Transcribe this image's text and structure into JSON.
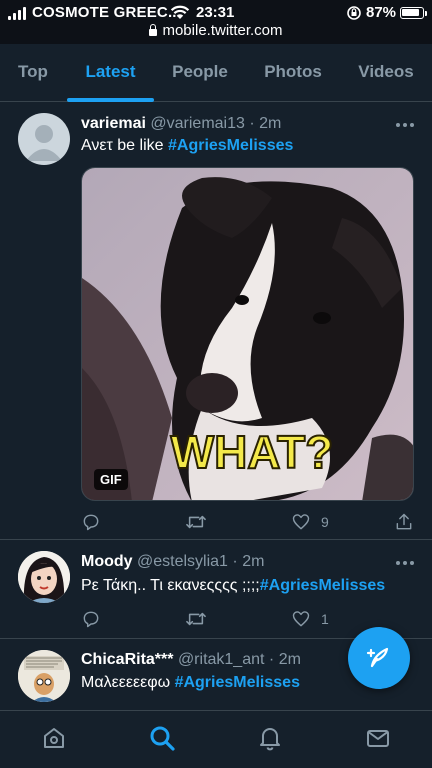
{
  "status_bar": {
    "carrier": "COSMOTE GREEC...",
    "time": "23:31",
    "battery": "87%",
    "battery_level": 0.87,
    "url": "mobile.twitter.com"
  },
  "tabs": [
    {
      "label": "Top"
    },
    {
      "label": "Latest"
    },
    {
      "label": "People"
    },
    {
      "label": "Photos"
    },
    {
      "label": "Videos"
    }
  ],
  "active_tab": "Latest",
  "tweets": [
    {
      "name": "variemai",
      "handle": "@variemai13",
      "dot": "·",
      "time": "2m",
      "text": "Ανετ be like ",
      "hashtag": "#AgriesMelisses",
      "media": {
        "caption": "WHAT?",
        "badge": "GIF"
      },
      "replies": "",
      "retweets": "",
      "likes": "9"
    },
    {
      "name": "Moody",
      "handle": "@estelsylia1",
      "dot": "·",
      "time": "2m",
      "text": "Ρε Τάκη.. Τι εκανεςςςς ;;;;",
      "hashtag": "#AgriesMelisses",
      "replies": "",
      "retweets": "",
      "likes": "1"
    },
    {
      "name": "ChicaRita***",
      "handle": "@ritak1_ant",
      "dot": "·",
      "time": "2m",
      "text": "Μαλεεεεεφω ",
      "hashtag": "#AgriesMelisses"
    }
  ],
  "colors": {
    "background": "#15202b",
    "accent": "#1da1f2",
    "secondary_text": "#8899a6",
    "divider": "#38444d"
  },
  "icons": {
    "compose": "compose-tweet-icon",
    "nav": [
      "home-icon",
      "search-icon",
      "notifications-icon",
      "messages-icon"
    ]
  }
}
